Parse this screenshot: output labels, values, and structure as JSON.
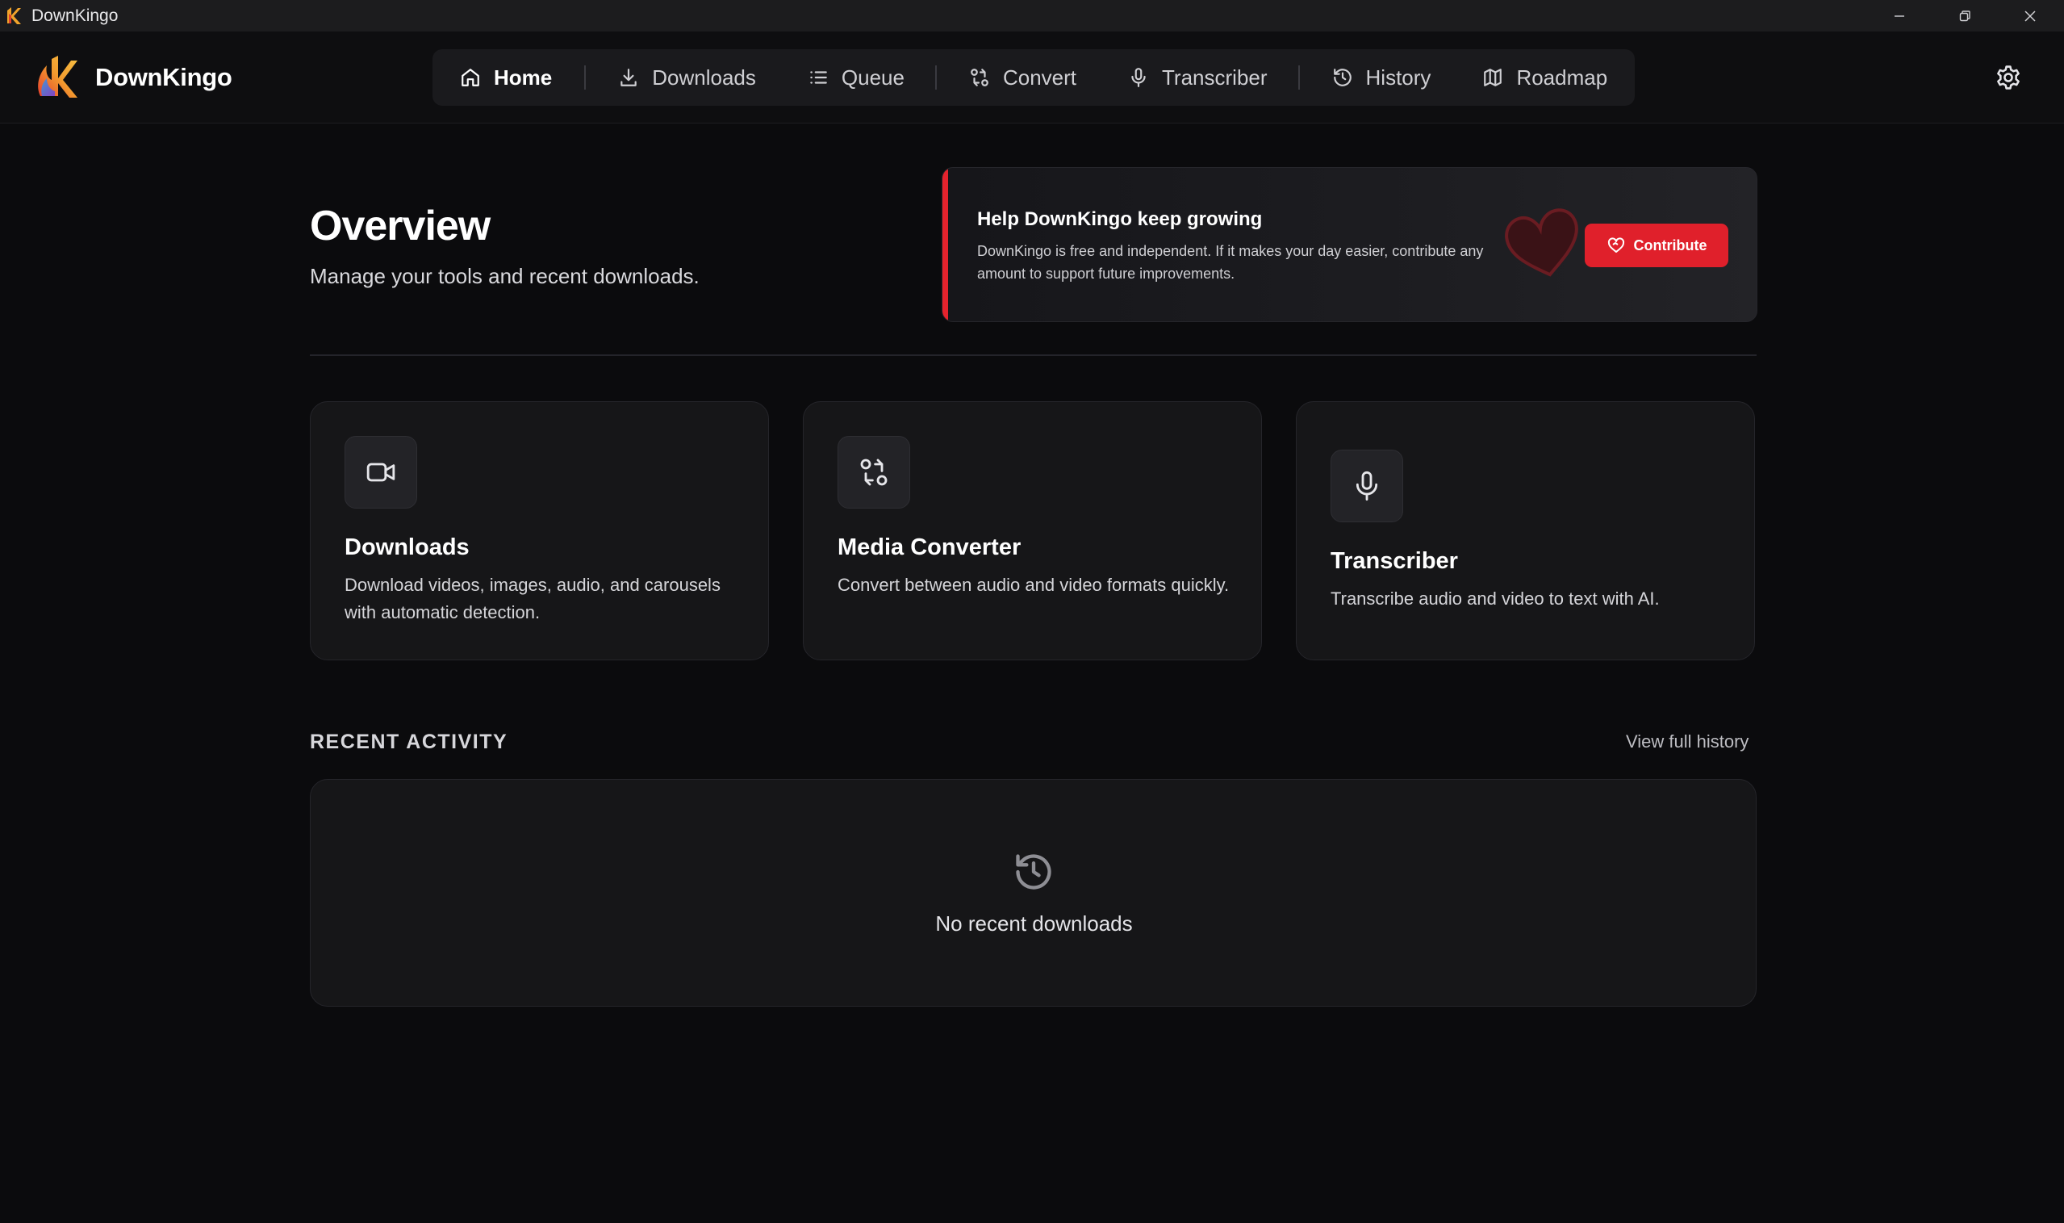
{
  "window": {
    "title": "DownKingo"
  },
  "header": {
    "brand": "DownKingo"
  },
  "nav": {
    "items": [
      {
        "label": "Home",
        "icon": "home-icon",
        "active": true
      },
      {
        "label": "Downloads",
        "icon": "download-icon",
        "active": false
      },
      {
        "label": "Queue",
        "icon": "list-icon",
        "active": false
      },
      {
        "label": "Convert",
        "icon": "convert-icon",
        "active": false
      },
      {
        "label": "Transcriber",
        "icon": "microphone-icon",
        "active": false
      },
      {
        "label": "History",
        "icon": "history-icon",
        "active": false
      },
      {
        "label": "Roadmap",
        "icon": "map-icon",
        "active": false
      }
    ]
  },
  "overview": {
    "title": "Overview",
    "subtitle": "Manage your tools and recent downloads."
  },
  "banner": {
    "title": "Help DownKingo keep growing",
    "text": "DownKingo is free and independent. If it makes your day easier, contribute any amount to support future improvements.",
    "button": "Contribute"
  },
  "cards": [
    {
      "title": "Downloads",
      "description": "Download videos, images, audio, and carousels with automatic detection.",
      "icon": "video-icon"
    },
    {
      "title": "Media Converter",
      "description": "Convert between audio and video formats quickly.",
      "icon": "convert-icon"
    },
    {
      "title": "Transcriber",
      "description": "Transcribe audio and video to text with AI.",
      "icon": "microphone-icon"
    }
  ],
  "recent": {
    "heading": "RECENT ACTIVITY",
    "link": "View full history",
    "empty": "No recent downloads"
  },
  "colors": {
    "accent": "#e0202b",
    "background": "#0b0b0d",
    "card": "#161618"
  }
}
